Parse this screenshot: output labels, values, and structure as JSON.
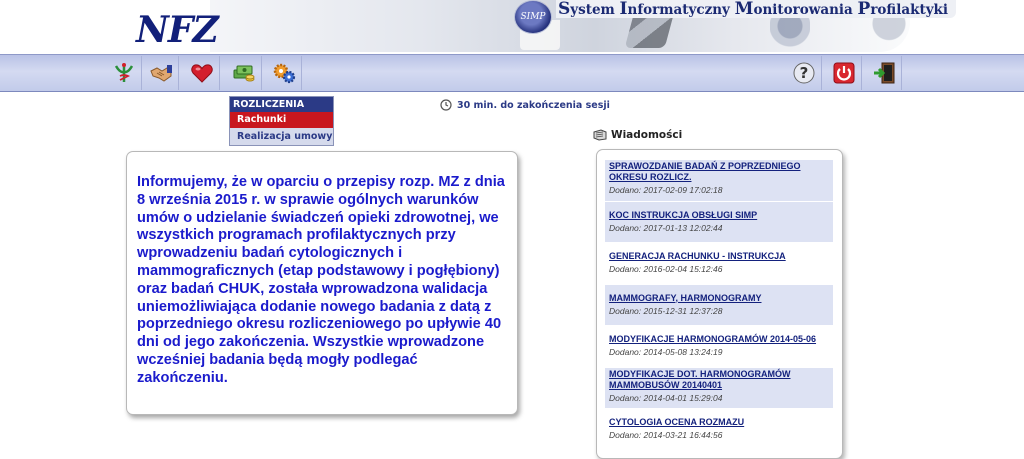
{
  "header": {
    "logo": "NFZ",
    "badge": "SIMP",
    "title_parts": [
      {
        "cap": "S",
        "rest": "ystem "
      },
      {
        "cap": "I",
        "rest": "nformatyczny "
      },
      {
        "cap": "M",
        "rest": "onitorowania "
      },
      {
        "cap": "P",
        "rest": "rofilaktyki"
      }
    ]
  },
  "toolbar": {
    "left_icons": [
      "medical-caduceus-icon",
      "handshake-icon",
      "heart-icon",
      "money-icon",
      "gears-icon"
    ],
    "right_icons": [
      "help-icon",
      "power-icon",
      "logout-icon"
    ]
  },
  "submenu": {
    "header": "ROZLICZENIA",
    "items": [
      "Rachunki",
      "Realizacja umowy"
    ]
  },
  "session": {
    "label": "30 min. do zakończenia sesji"
  },
  "info": {
    "text": "Informujemy, że w oparciu o przepisy rozp. MZ z dnia 8 września 2015 r. w sprawie ogólnych warunków umów o udzielanie świadczeń opieki zdrowotnej, we wszystkich programach profilaktycznych przy wprowadzeniu badań cytologicznych i mammograficznych (etap podstawowy i pogłębiony) oraz badań CHUK, została wprowadzona walidacja uniemożliwiająca dodanie nowego badania z datą z poprzedniego okresu rozliczeniowego po upływie 40 dni od jego zakończenia. Wszystkie wprowadzone wcześniej badania będą mogły podlegać zakończeniu."
  },
  "news": {
    "heading": "Wiadomości",
    "items": [
      {
        "title": "SPRAWOZDANIE BADAŃ Z POPRZEDNIEGO OKRESU ROZLICZ.",
        "date": "Dodano: 2017-02-09  17:02:18"
      },
      {
        "title": "KOC INSTRUKCJA OBSŁUGI SIMP",
        "date": "Dodano: 2017-01-13  12:02:44"
      },
      {
        "title": "GENERACJA RACHUNKU - INSTRUKCJA",
        "date": "Dodano: 2016-02-04  15:12:46"
      },
      {
        "title": "MAMMOGRAFY, HARMONOGRAMY",
        "date": "Dodano: 2015-12-31  12:37:28"
      },
      {
        "title": "MODYFIKACJE HARMONOGRAMÓW 2014-05-06",
        "date": "Dodano: 2014-05-08  13:24:19"
      },
      {
        "title": "MODYFIKACJE DOT. HARMONOGRAMÓW MAMMOBUSÓW 20140401",
        "date": "Dodano: 2014-04-01  15:29:04"
      },
      {
        "title": "CYTOLOGIA  OCENA ROZMAZU",
        "date": "Dodano: 2014-03-21  16:44:56"
      }
    ]
  }
}
